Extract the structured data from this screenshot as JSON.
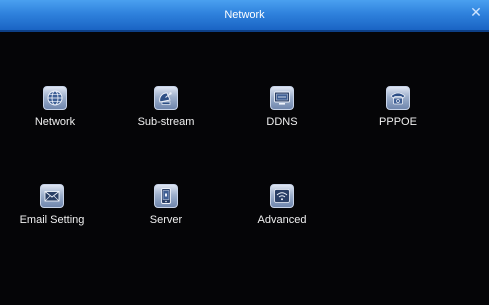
{
  "window": {
    "title": "Network",
    "close_glyph": "✕"
  },
  "menu": [
    {
      "label": "Network",
      "icon": "globe-icon"
    },
    {
      "label": "Sub-stream",
      "icon": "satellite-icon"
    },
    {
      "label": "DDNS",
      "icon": "ddns-icon"
    },
    {
      "label": "PPPOE",
      "icon": "phone-icon"
    },
    {
      "label": "Email Setting",
      "icon": "envelope-icon"
    },
    {
      "label": "Server",
      "icon": "mobile-icon"
    },
    {
      "label": "Advanced",
      "icon": "wifi-icon"
    }
  ],
  "colors": {
    "titlebar": "#2f82dd",
    "background": "#050507",
    "text": "#f0f0f0"
  }
}
